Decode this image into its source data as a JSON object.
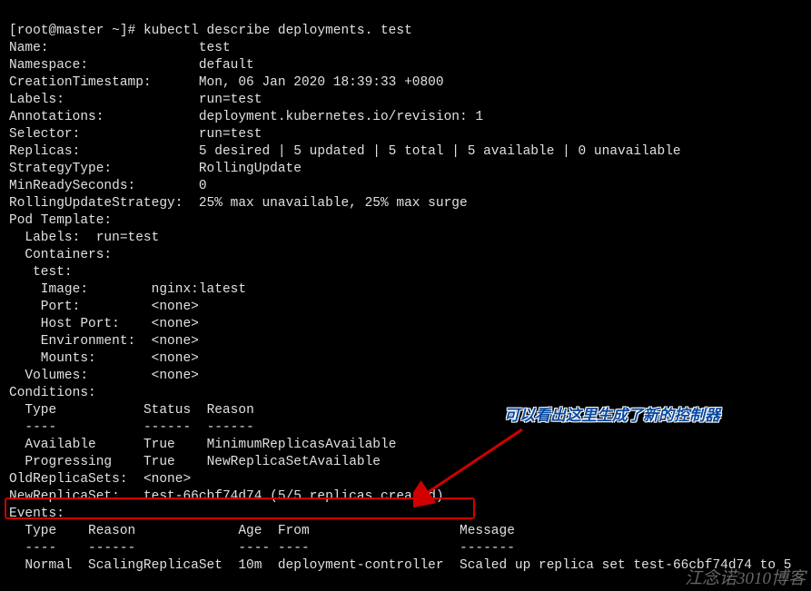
{
  "prompt": {
    "user_host": "[root@master ~]#",
    "command": "kubectl describe deployments. test"
  },
  "fields": {
    "name": {
      "label": "Name:",
      "value": "test"
    },
    "namespace": {
      "label": "Namespace:",
      "value": "default"
    },
    "creation_timestamp": {
      "label": "CreationTimestamp:",
      "value": "Mon, 06 Jan 2020 18:39:33 +0800"
    },
    "labels": {
      "label": "Labels:",
      "value": "run=test"
    },
    "annotations": {
      "label": "Annotations:",
      "value": "deployment.kubernetes.io/revision: 1"
    },
    "selector": {
      "label": "Selector:",
      "value": "run=test"
    },
    "replicas": {
      "label": "Replicas:",
      "value": "5 desired | 5 updated | 5 total | 5 available | 0 unavailable"
    },
    "strategy_type": {
      "label": "StrategyType:",
      "value": "RollingUpdate"
    },
    "min_ready_seconds": {
      "label": "MinReadySeconds:",
      "value": "0"
    },
    "rolling_update": {
      "label": "RollingUpdateStrategy:",
      "value": "25% max unavailable, 25% max surge"
    }
  },
  "pod_template": {
    "header": "Pod Template:",
    "labels_line": "  Labels:  run=test",
    "containers_header": "  Containers:",
    "container_name": "   test:",
    "rows": {
      "image": {
        "label": "    Image:",
        "value": "nginx:latest"
      },
      "port": {
        "label": "    Port:",
        "value": "<none>"
      },
      "host_port": {
        "label": "    Host Port:",
        "value": "<none>"
      },
      "environment": {
        "label": "    Environment:",
        "value": "<none>"
      },
      "mounts": {
        "label": "    Mounts:",
        "value": "<none>"
      }
    },
    "volumes": {
      "label": "  Volumes:",
      "value": "<none>"
    }
  },
  "conditions": {
    "header": "Conditions:",
    "col_type": "  Type",
    "col_status": "Status",
    "col_reason": "Reason",
    "sep_type": "  ----",
    "sep_status": "------",
    "sep_reason": "------",
    "rows": [
      {
        "type": "  Available",
        "status": "True",
        "reason": "MinimumReplicasAvailable"
      },
      {
        "type": "  Progressing",
        "status": "True",
        "reason": "NewReplicaSetAvailable"
      }
    ]
  },
  "replica_sets": {
    "old": {
      "label": "OldReplicaSets:",
      "value": "<none>"
    },
    "new": {
      "label": "NewReplicaSet:",
      "value": "test-66cbf74d74 (5/5 replicas created)"
    }
  },
  "events": {
    "header": "Events:",
    "cols": {
      "type": "  Type",
      "reason": "Reason",
      "age": "Age",
      "from": "From",
      "message": "Message"
    },
    "seps": {
      "type": "  ----",
      "reason": "------",
      "age": "----",
      "from": "----",
      "message": "-------"
    },
    "row": {
      "type": "  Normal",
      "reason": "ScalingReplicaSet",
      "age": "10m",
      "from": "deployment-controller",
      "message": "Scaled up replica set test-66cbf74d74 to 5"
    }
  },
  "annotation": {
    "text": "可以看出这里生成了新的控制器"
  },
  "watermark": "江念诺3010博客"
}
